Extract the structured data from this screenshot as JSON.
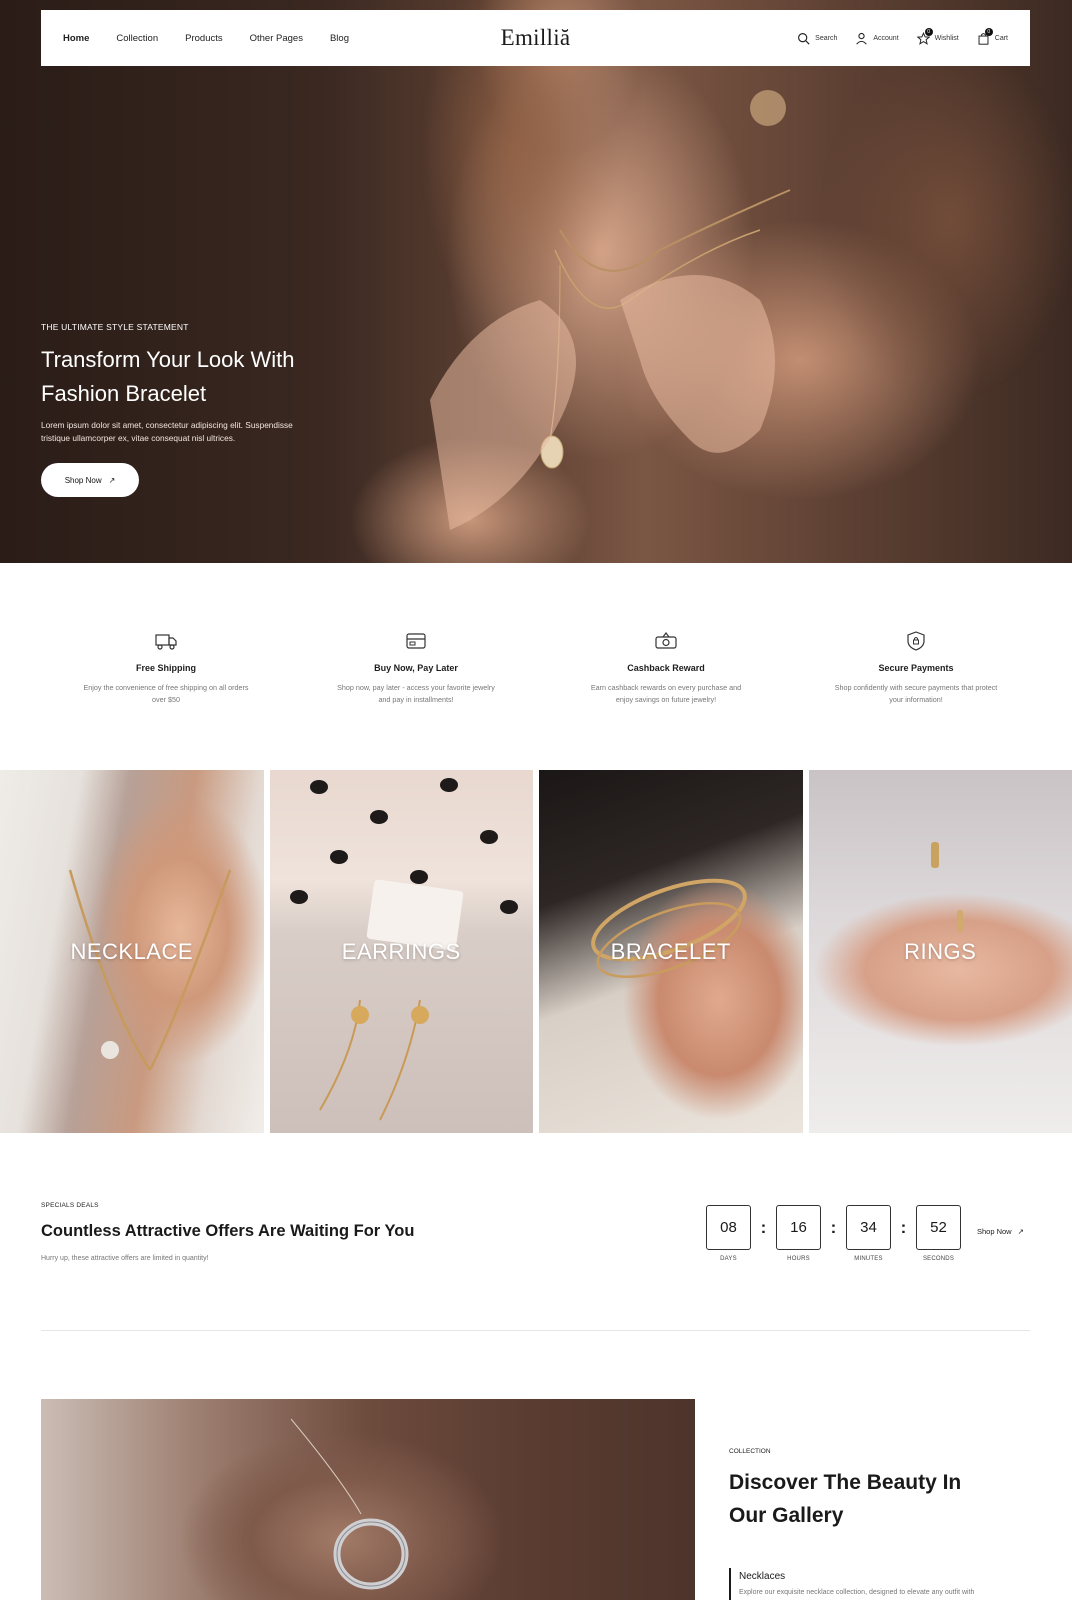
{
  "header": {
    "nav": [
      "Home",
      "Collection",
      "Products",
      "Other Pages",
      "Blog"
    ],
    "logo": "Emilliă",
    "actions": {
      "search": "Search",
      "account": "Account",
      "wishlist": "Wishlist",
      "wishlist_count": "0",
      "cart": "Cart",
      "cart_count": "0"
    }
  },
  "hero": {
    "eyebrow": "THE ULTIMATE STYLE STATEMENT",
    "title": "Transform Your Look With Fashion Bracelet",
    "description": "Lorem ipsum dolor sit amet, consectetur adipiscing elit. Suspendisse tristique ullamcorper ex, vitae consequat nisl ultrices.",
    "button": "Shop Now"
  },
  "features": [
    {
      "icon": "truck-icon",
      "title": "Free Shipping",
      "desc": "Enjoy the convenience of free shipping on all orders over $50"
    },
    {
      "icon": "card-icon",
      "title": "Buy Now, Pay Later",
      "desc": "Shop now, pay later - access your favorite jewelry and pay in installments!"
    },
    {
      "icon": "cash-icon",
      "title": "Cashback Reward",
      "desc": "Earn cashback rewards on every purchase and enjoy savings on future jewelry!"
    },
    {
      "icon": "shield-icon",
      "title": "Secure Payments",
      "desc": "Shop confidently with secure payments that protect your information!"
    }
  ],
  "categories": [
    "NECKLACE",
    "EARRINGS",
    "BRACELET",
    "RINGS"
  ],
  "deals": {
    "eyebrow": "SPECIALS DEALS",
    "title": "Countless Attractive Offers Are Waiting For You",
    "subtitle": "Hurry up, these attractive offers are limited in quantity!",
    "countdown": {
      "days": "08",
      "hours": "16",
      "minutes": "34",
      "seconds": "52",
      "days_label": "DAYS",
      "hours_label": "HOURS",
      "minutes_label": "MINUTES",
      "seconds_label": "SECONDS"
    },
    "button": "Shop Now"
  },
  "gallery": {
    "eyebrow": "COLLECTION",
    "title": "Discover The Beauty In Our Gallery",
    "item_title": "Necklaces",
    "item_desc": "Explore our exquisite necklace collection, designed to elevate any outfit with"
  }
}
